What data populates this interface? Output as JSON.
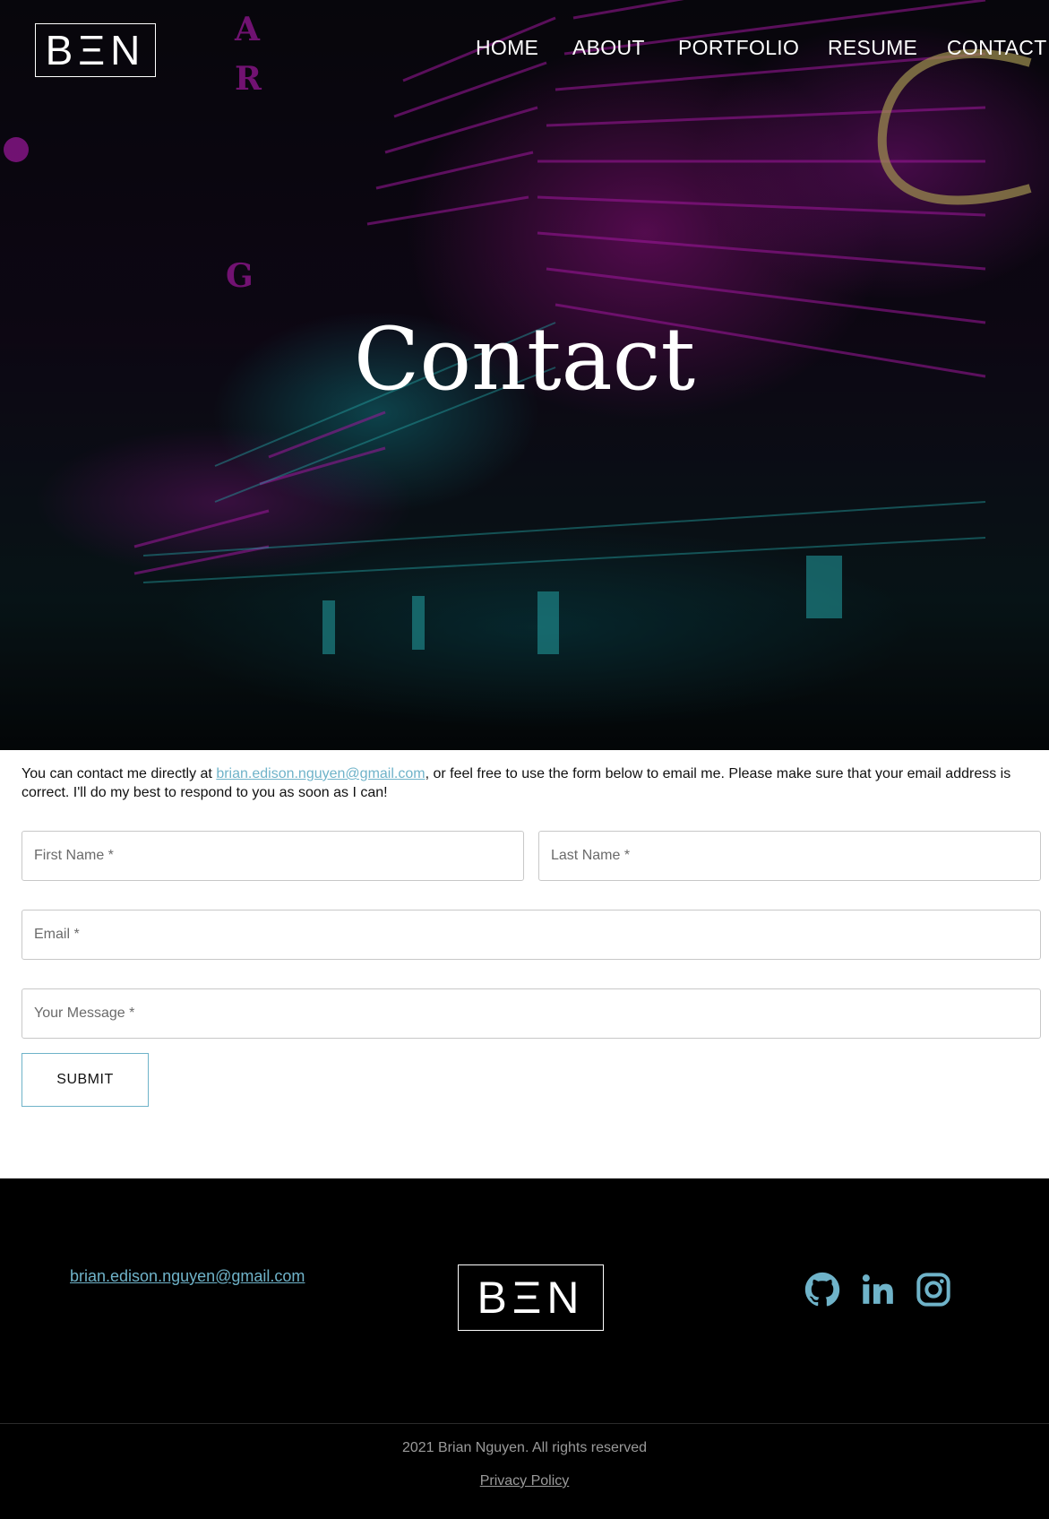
{
  "header": {
    "logo_text": "BΞN",
    "nav": [
      {
        "label": "HOME"
      },
      {
        "label": "ABOUT"
      },
      {
        "label": "PORTFOLIO"
      },
      {
        "label": "RESUME"
      },
      {
        "label": "CONTACT"
      }
    ]
  },
  "hero": {
    "title": "Contact"
  },
  "intro": {
    "before": "You can contact me directly at ",
    "email": "brian.edison.nguyen@gmail.com",
    "after": ", or feel free to use the form below to email me. Please make sure that your email address is correct. I'll do my best to respond to you as soon as I can!"
  },
  "form": {
    "first_name_placeholder": "First Name *",
    "last_name_placeholder": "Last Name *",
    "email_placeholder": "Email *",
    "message_placeholder": "Your Message *",
    "submit_label": "SUBMIT"
  },
  "footer": {
    "email": "brian.edison.nguyen@gmail.com",
    "logo_text": "BΞN",
    "social": [
      {
        "icon": "github-icon"
      },
      {
        "icon": "linkedin-icon"
      },
      {
        "icon": "instagram-icon"
      }
    ],
    "copyright": "2021 Brian Nguyen. All rights reserved",
    "privacy_label": "Privacy Policy"
  },
  "colors": {
    "accent": "#6fb3c9",
    "footer_bg": "#000000",
    "neon_magenta": "#d21fd0",
    "neon_cyan": "#2fd6d8"
  }
}
